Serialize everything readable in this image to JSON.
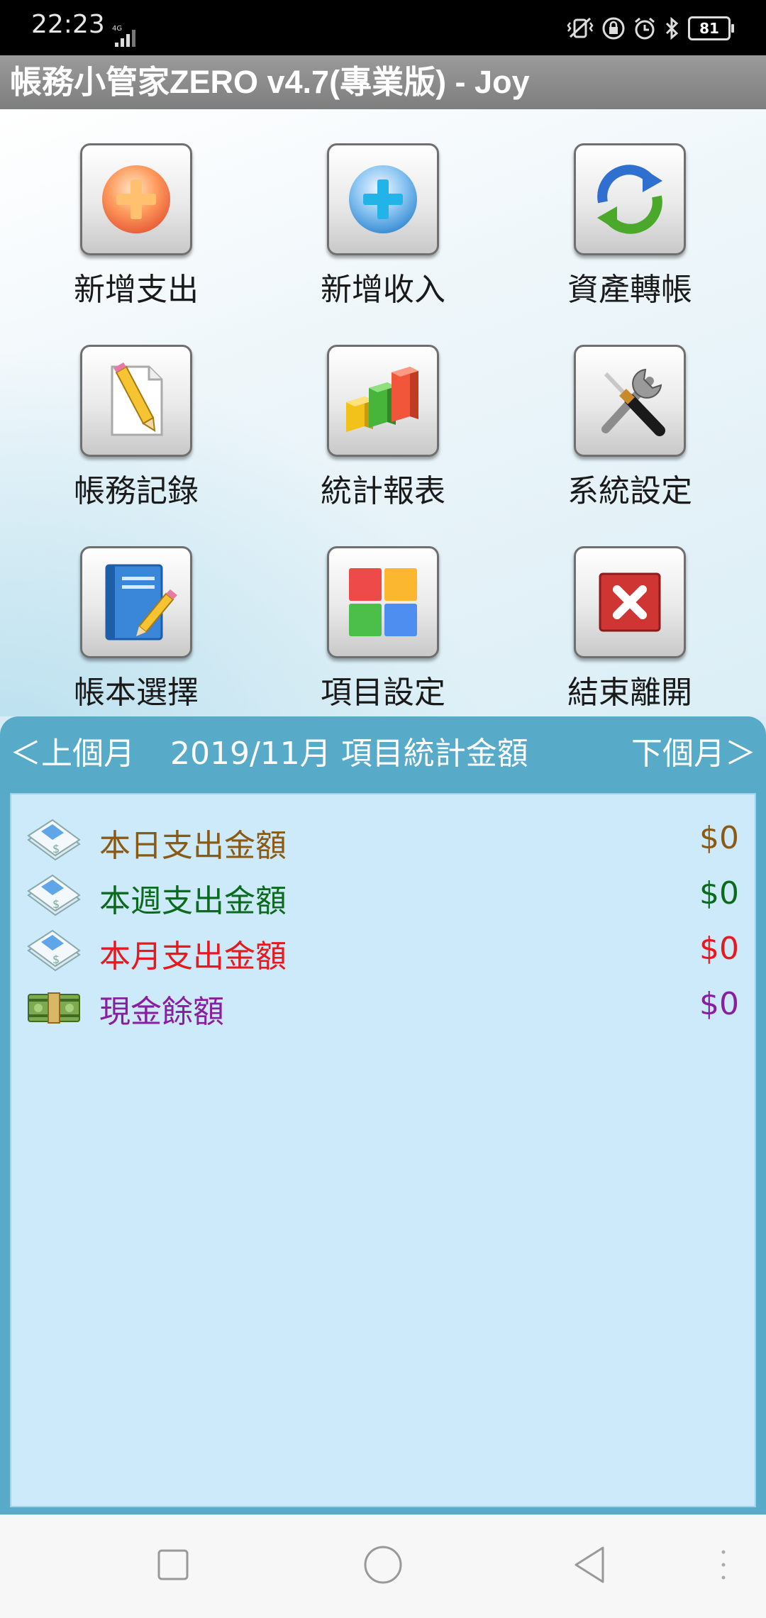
{
  "status_bar": {
    "time": "22:23",
    "network": "4G",
    "battery": "81",
    "icons": [
      "vibrate-icon",
      "lock-rotation-icon",
      "alarm-icon",
      "bluetooth-icon",
      "battery-icon"
    ]
  },
  "app_title": "帳務小管家ZERO v4.7(專業版) - Joy",
  "menu": [
    {
      "label": "新增支出",
      "icon": "add-expense-icon"
    },
    {
      "label": "新增收入",
      "icon": "add-income-icon"
    },
    {
      "label": "資產轉帳",
      "icon": "transfer-icon"
    },
    {
      "label": "帳務記錄",
      "icon": "records-icon"
    },
    {
      "label": "統計報表",
      "icon": "report-icon"
    },
    {
      "label": "系統設定",
      "icon": "settings-icon"
    },
    {
      "label": "帳本選擇",
      "icon": "ledger-icon"
    },
    {
      "label": "項目設定",
      "icon": "category-icon"
    },
    {
      "label": "結束離開",
      "icon": "exit-icon"
    }
  ],
  "stats": {
    "prev_label": "＜上個月",
    "period": "2019/11月 項目統計金額",
    "next_label": "下個月＞",
    "items": [
      {
        "label": "本日支出金額",
        "value": "$0",
        "color": "#8a5a14"
      },
      {
        "label": "本週支出金額",
        "value": "$0",
        "color": "#0b6a1e"
      },
      {
        "label": "本月支出金額",
        "value": "$0",
        "color": "#e8181e"
      },
      {
        "label": "現金餘額",
        "value": "$0",
        "color": "#8a1ea0"
      }
    ]
  },
  "colors": {
    "panel": "#57aac8",
    "panel_body": "#cdeafa",
    "title_bar": "#888888"
  }
}
